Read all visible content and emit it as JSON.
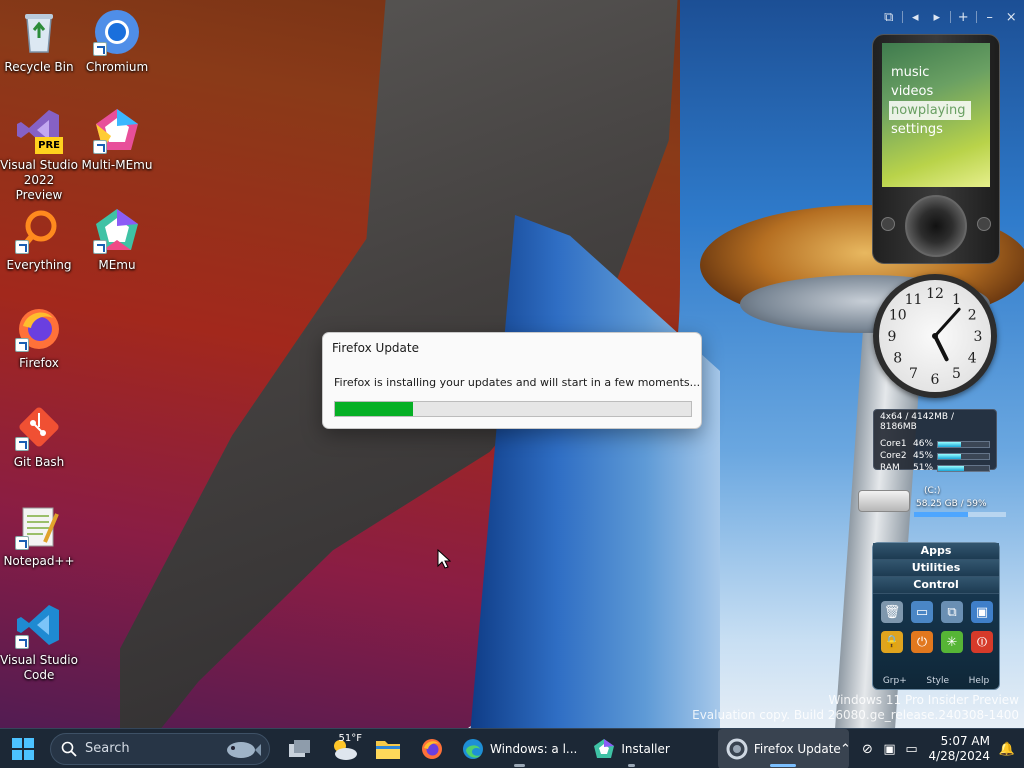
{
  "desktop": {
    "icons": [
      {
        "label": "Recycle Bin",
        "icon": "recycle-bin-icon"
      },
      {
        "label": "Chromium",
        "icon": "chromium-icon"
      },
      {
        "label": "Visual Studio 2022 Preview",
        "icon": "visual-studio-icon",
        "badge": "PRE"
      },
      {
        "label": "Multi-MEmu",
        "icon": "multi-memu-icon"
      },
      {
        "label": "Everything",
        "icon": "everything-icon"
      },
      {
        "label": "MEmu",
        "icon": "memu-icon"
      },
      {
        "label": "Firefox",
        "icon": "firefox-icon"
      },
      {
        "label": "Git Bash",
        "icon": "git-bash-icon"
      },
      {
        "label": "Notepad++",
        "icon": "notepad-plus-plus-icon"
      },
      {
        "label": "Visual Studio Code",
        "icon": "vscode-icon"
      }
    ]
  },
  "dialog": {
    "title": "Firefox Update",
    "message": "Firefox is installing your updates and will start in a few moments...",
    "progress": 0.22,
    "progress_color": "#06b025"
  },
  "gadgets": {
    "toolbar": [
      "restore-icon",
      "prev-icon",
      "next-icon",
      "add-icon",
      "minimize-icon",
      "close-icon"
    ],
    "zune": {
      "menu": [
        "music",
        "videos",
        "nowplaying",
        "settings"
      ],
      "active": "nowplaying"
    },
    "clock": {
      "time": "5:07",
      "numerals": [
        "12",
        "1",
        "2",
        "3",
        "4",
        "5",
        "6",
        "7",
        "8",
        "9",
        "10",
        "11"
      ]
    },
    "meter": {
      "header": "4x64 / 4142MB / 8186MB",
      "rows": [
        {
          "label": "Core1",
          "value": "46%",
          "level": 0.46
        },
        {
          "label": "Core2",
          "value": "45%",
          "level": 0.45
        },
        {
          "label": "RAM",
          "value": "51%",
          "level": 0.51
        }
      ]
    },
    "drive": {
      "label": "(C:)",
      "space": "58.25 GB / 59%",
      "level": 0.59
    },
    "launcher": {
      "tabs": [
        "Apps",
        "Utilities",
        "Control"
      ],
      "footer": [
        "Grp+",
        "Style",
        "Help"
      ]
    }
  },
  "watermark": {
    "line1": "Windows 11 Pro Insider Preview",
    "line2": "Evaluation copy. Build 26080.ge_release.240308-1400"
  },
  "taskbar": {
    "search_placeholder": "Search",
    "weather": "51°F",
    "apps": [
      {
        "label": "Windows: a l...",
        "icon": "edge-icon"
      },
      {
        "label": "Installer",
        "icon": "memu-icon"
      },
      {
        "label": "Firefox Update",
        "icon": "firefox-update-icon"
      }
    ],
    "time": "5:07 AM",
    "date": "4/28/2024"
  }
}
